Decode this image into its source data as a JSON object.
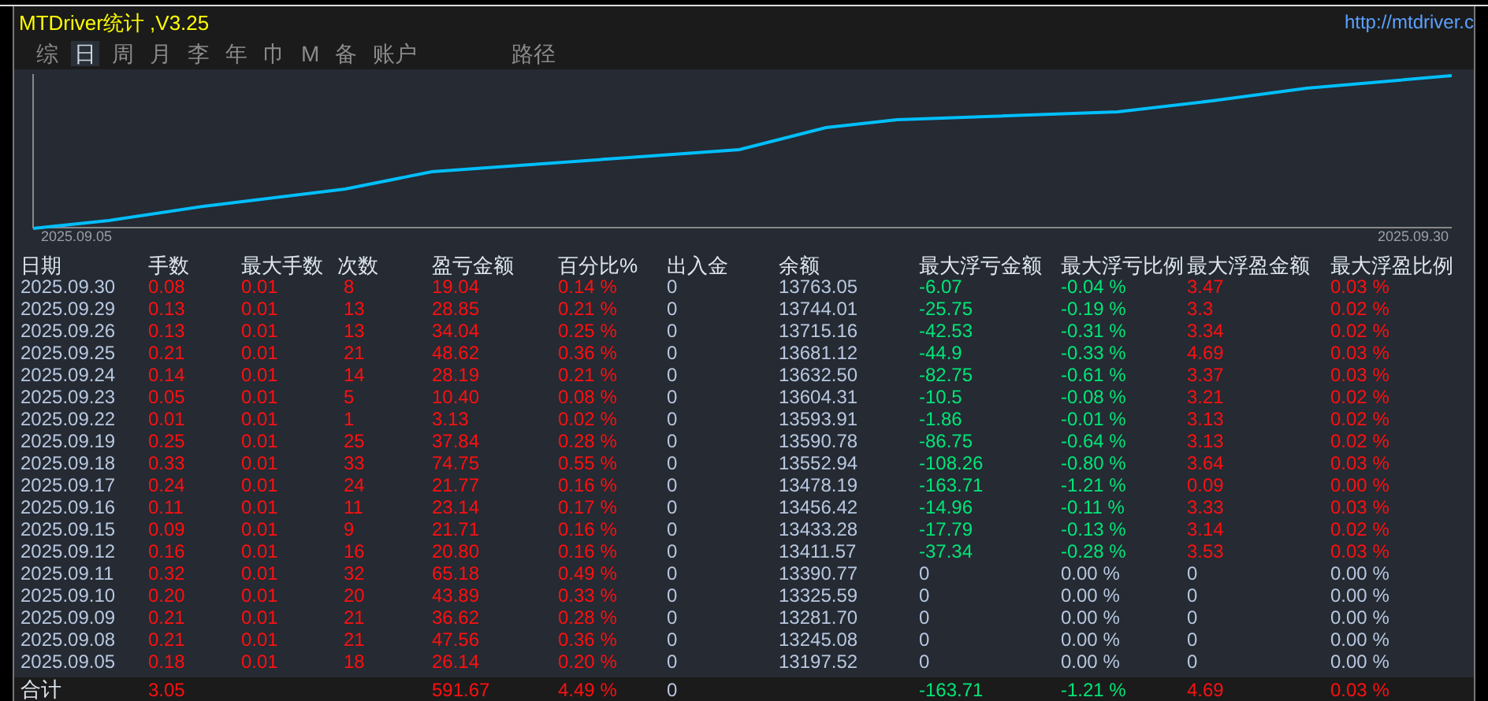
{
  "title": "MTDriver统计 ,V3.25",
  "url": "http://mtdriver.c",
  "tabs": [
    {
      "label": "综",
      "selected": false
    },
    {
      "label": "日",
      "selected": true
    },
    {
      "label": "周",
      "selected": false
    },
    {
      "label": "月",
      "selected": false
    },
    {
      "label": "李",
      "selected": false
    },
    {
      "label": "年",
      "selected": false
    },
    {
      "label": "巾",
      "selected": false
    },
    {
      "label": "M",
      "selected": false
    },
    {
      "label": "备",
      "selected": false
    },
    {
      "label": "账户",
      "selected": false
    },
    {
      "label": "路径",
      "selected": false
    }
  ],
  "chart": {
    "start_label": "2025.09.05",
    "end_label": "2025.09.30"
  },
  "table": {
    "columns": [
      "日期",
      "手数",
      "最大手数",
      "次数",
      "盈亏金额",
      "百分比%",
      "出入金",
      "余额",
      "最大浮亏金额",
      "最大浮亏比例",
      "最大浮盈金额",
      "最大浮盈比例"
    ],
    "rows": [
      {
        "floating": true,
        "cells": [
          "2025.09.30",
          "0.08",
          "0.01",
          "8",
          "19.04",
          "0.14 %",
          "0",
          "13763.05",
          "-6.07",
          "-0.04 %",
          "3.47",
          "0.03 %"
        ]
      },
      {
        "floating": true,
        "cells": [
          "2025.09.29",
          "0.13",
          "0.01",
          "13",
          "28.85",
          "0.21 %",
          "0",
          "13744.01",
          "-25.75",
          "-0.19 %",
          "3.3",
          "0.02 %"
        ]
      },
      {
        "floating": true,
        "cells": [
          "2025.09.26",
          "0.13",
          "0.01",
          "13",
          "34.04",
          "0.25 %",
          "0",
          "13715.16",
          "-42.53",
          "-0.31 %",
          "3.34",
          "0.02 %"
        ]
      },
      {
        "floating": true,
        "cells": [
          "2025.09.25",
          "0.21",
          "0.01",
          "21",
          "48.62",
          "0.36 %",
          "0",
          "13681.12",
          "-44.9",
          "-0.33 %",
          "4.69",
          "0.03 %"
        ]
      },
      {
        "floating": true,
        "cells": [
          "2025.09.24",
          "0.14",
          "0.01",
          "14",
          "28.19",
          "0.21 %",
          "0",
          "13632.50",
          "-82.75",
          "-0.61 %",
          "3.37",
          "0.03 %"
        ]
      },
      {
        "floating": true,
        "cells": [
          "2025.09.23",
          "0.05",
          "0.01",
          "5",
          "10.40",
          "0.08 %",
          "0",
          "13604.31",
          "-10.5",
          "-0.08 %",
          "3.21",
          "0.02 %"
        ]
      },
      {
        "floating": true,
        "cells": [
          "2025.09.22",
          "0.01",
          "0.01",
          "1",
          "3.13",
          "0.02 %",
          "0",
          "13593.91",
          "-1.86",
          "-0.01 %",
          "3.13",
          "0.02 %"
        ]
      },
      {
        "floating": true,
        "cells": [
          "2025.09.19",
          "0.25",
          "0.01",
          "25",
          "37.84",
          "0.28 %",
          "0",
          "13590.78",
          "-86.75",
          "-0.64 %",
          "3.13",
          "0.02 %"
        ]
      },
      {
        "floating": true,
        "cells": [
          "2025.09.18",
          "0.33",
          "0.01",
          "33",
          "74.75",
          "0.55 %",
          "0",
          "13552.94",
          "-108.26",
          "-0.80 %",
          "3.64",
          "0.03 %"
        ]
      },
      {
        "floating": true,
        "cells": [
          "2025.09.17",
          "0.24",
          "0.01",
          "24",
          "21.77",
          "0.16 %",
          "0",
          "13478.19",
          "-163.71",
          "-1.21 %",
          "0.09",
          "0.00 %"
        ]
      },
      {
        "floating": true,
        "cells": [
          "2025.09.16",
          "0.11",
          "0.01",
          "11",
          "23.14",
          "0.17 %",
          "0",
          "13456.42",
          "-14.96",
          "-0.11 %",
          "3.33",
          "0.03 %"
        ]
      },
      {
        "floating": true,
        "cells": [
          "2025.09.15",
          "0.09",
          "0.01",
          "9",
          "21.71",
          "0.16 %",
          "0",
          "13433.28",
          "-17.79",
          "-0.13 %",
          "3.14",
          "0.02 %"
        ]
      },
      {
        "floating": true,
        "cells": [
          "2025.09.12",
          "0.16",
          "0.01",
          "16",
          "20.80",
          "0.16 %",
          "0",
          "13411.57",
          "-37.34",
          "-0.28 %",
          "3.53",
          "0.03 %"
        ]
      },
      {
        "floating": false,
        "cells": [
          "2025.09.11",
          "0.32",
          "0.01",
          "32",
          "65.18",
          "0.49 %",
          "0",
          "13390.77",
          "0",
          "0.00 %",
          "0",
          "0.00 %"
        ]
      },
      {
        "floating": false,
        "cells": [
          "2025.09.10",
          "0.20",
          "0.01",
          "20",
          "43.89",
          "0.33 %",
          "0",
          "13325.59",
          "0",
          "0.00 %",
          "0",
          "0.00 %"
        ]
      },
      {
        "floating": false,
        "cells": [
          "2025.09.09",
          "0.21",
          "0.01",
          "21",
          "36.62",
          "0.28 %",
          "0",
          "13281.70",
          "0",
          "0.00 %",
          "0",
          "0.00 %"
        ]
      },
      {
        "floating": false,
        "cells": [
          "2025.09.08",
          "0.21",
          "0.01",
          "21",
          "47.56",
          "0.36 %",
          "0",
          "13245.08",
          "0",
          "0.00 %",
          "0",
          "0.00 %"
        ]
      },
      {
        "floating": false,
        "cells": [
          "2025.09.05",
          "0.18",
          "0.01",
          "18",
          "26.14",
          "0.20 %",
          "0",
          "13197.52",
          "0",
          "0.00 %",
          "0",
          "0.00 %"
        ]
      }
    ],
    "total": {
      "label": "合计",
      "cells": [
        "3.05",
        "",
        "",
        "591.67",
        "4.49 %",
        "0",
        "",
        "-163.71",
        "-1.21 %",
        "4.69",
        "0.03 %"
      ]
    }
  }
}
